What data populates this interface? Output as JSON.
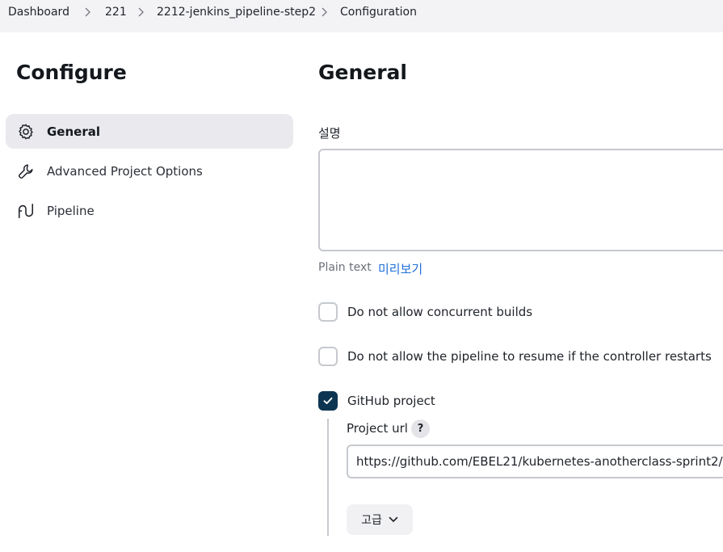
{
  "breadcrumb": {
    "items": [
      "Dashboard",
      "221",
      "2212-jenkins_pipeline-step2",
      "Configuration"
    ]
  },
  "sidebar": {
    "title": "Configure",
    "items": [
      {
        "label": "General",
        "icon": "gear-icon",
        "active": true
      },
      {
        "label": "Advanced Project Options",
        "icon": "wrench-icon",
        "active": false
      },
      {
        "label": "Pipeline",
        "icon": "pipeline-icon",
        "active": false
      }
    ]
  },
  "main": {
    "title": "General",
    "description": {
      "label": "설명",
      "value": "",
      "format_text": "Plain text",
      "preview_link": "미리보기"
    },
    "options": [
      {
        "label": "Do not allow concurrent builds",
        "checked": false
      },
      {
        "label": "Do not allow the pipeline to resume if the controller restarts",
        "checked": false
      },
      {
        "label": "GitHub project",
        "checked": true
      }
    ],
    "github": {
      "url_label": "Project url",
      "help": "?",
      "url_value": "https://github.com/EBEL21/kubernetes-anotherclass-sprint2/",
      "advanced_label": "고급"
    }
  },
  "colors": {
    "accent": "#0d3551",
    "link": "#1e6fd9",
    "breadcrumb_bg": "#f3f3f6",
    "active_item_bg": "#eaeaee"
  }
}
